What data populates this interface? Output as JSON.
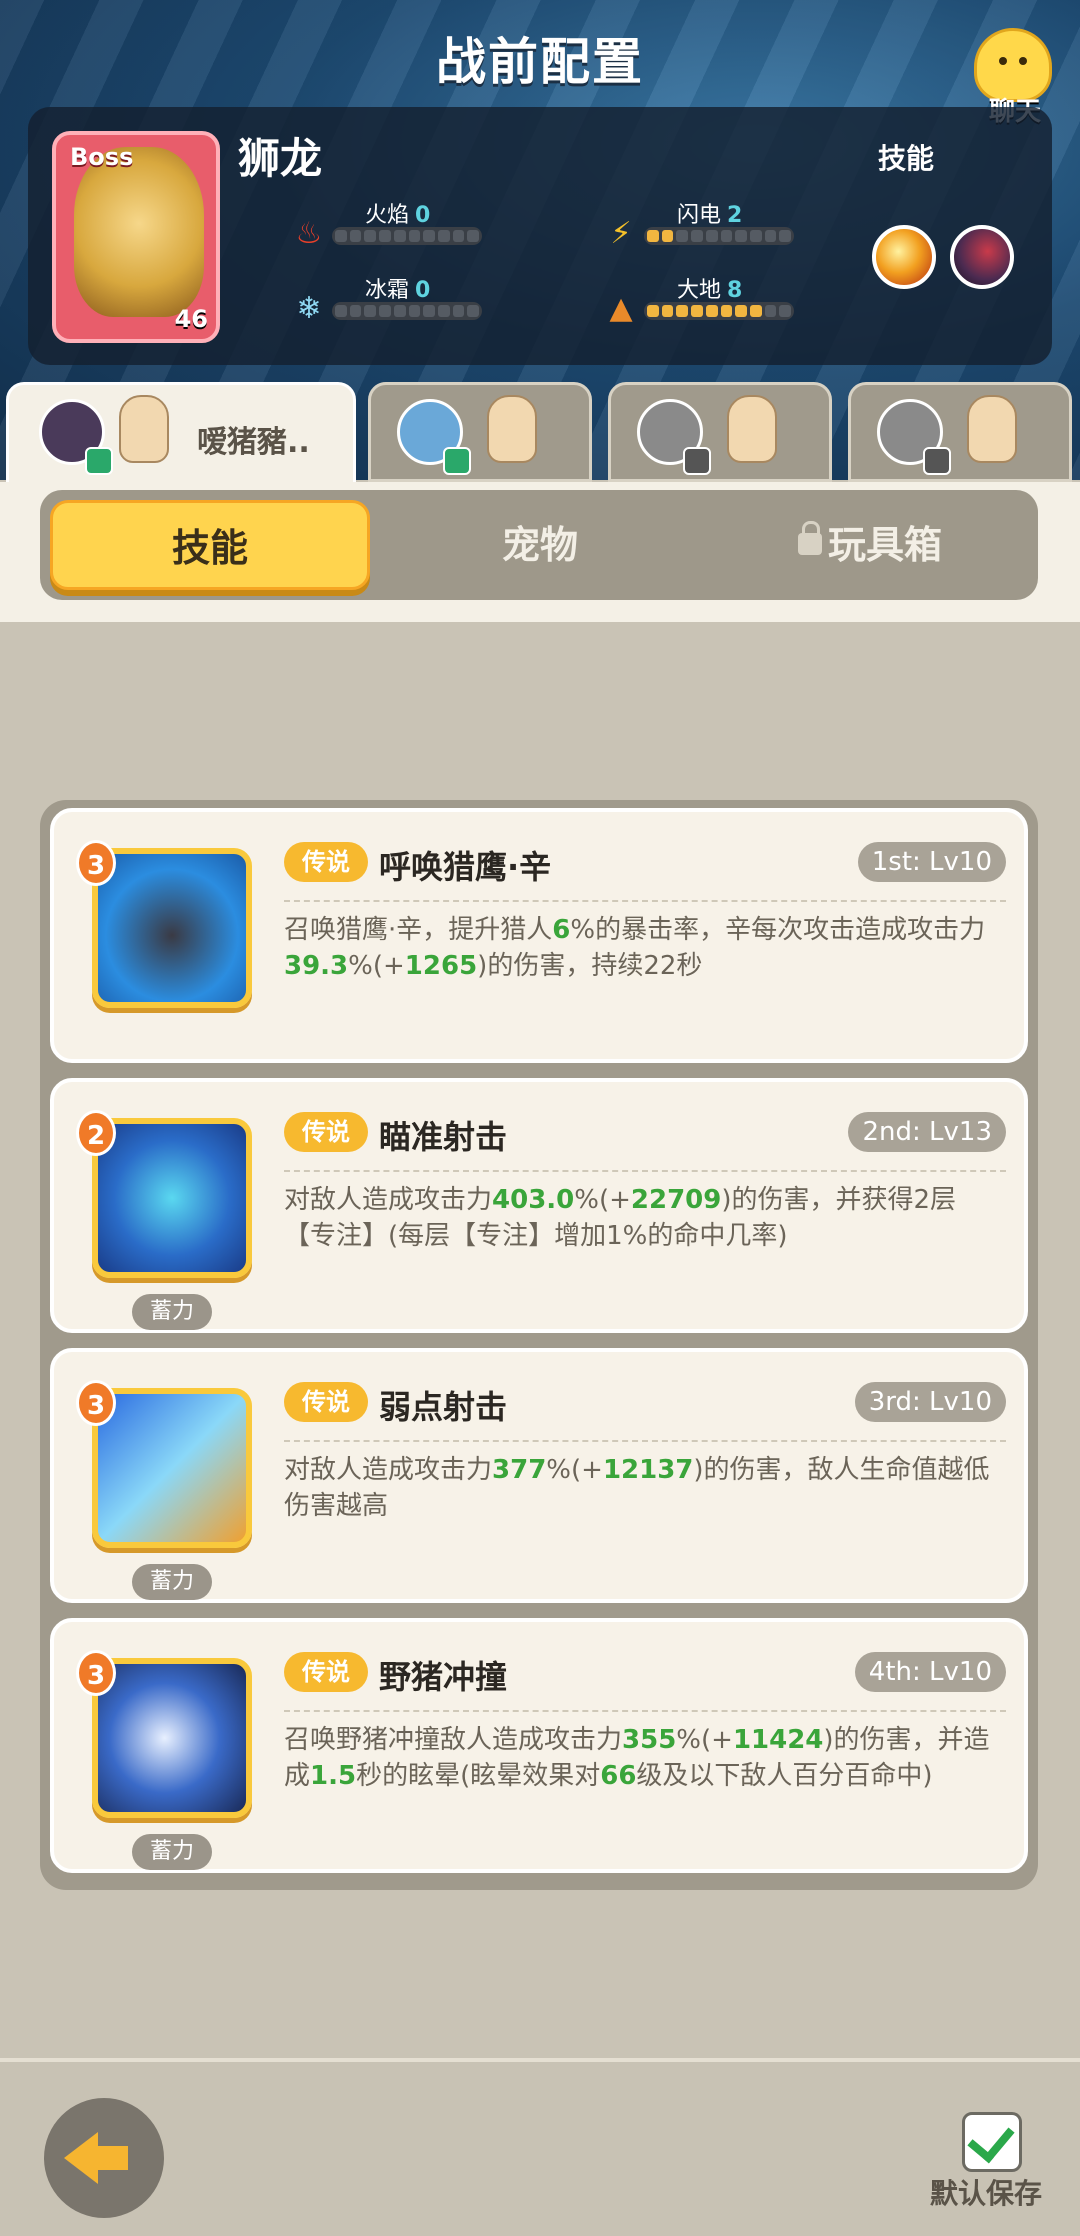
{
  "header": {
    "title": "战前配置",
    "chat_label": "聊天"
  },
  "boss": {
    "tag": "Boss",
    "name": "狮龙",
    "level": "46",
    "elements": [
      {
        "label": "火焰",
        "value": "0",
        "filled": 0,
        "icon": "fire-icon"
      },
      {
        "label": "闪电",
        "value": "2",
        "filled": 2,
        "icon": "lightning-icon"
      },
      {
        "label": "冰霜",
        "value": "0",
        "filled": 0,
        "icon": "frost-icon"
      },
      {
        "label": "大地",
        "value": "8",
        "filled": 8,
        "icon": "earth-icon"
      }
    ],
    "skills_label": "技能"
  },
  "hero_tabs": [
    {
      "name": "嗳猪豬..",
      "active": true,
      "badge": "online"
    },
    {
      "name": "",
      "active": false,
      "badge": "online"
    },
    {
      "name": "",
      "active": false,
      "badge": "offline"
    },
    {
      "name": "",
      "active": false,
      "badge": "offline"
    }
  ],
  "section_tabs": {
    "skills": "技能",
    "pets": "宠物",
    "toybox": "玩具箱"
  },
  "cards": [
    {
      "badge": "3",
      "rarity": "传说",
      "name": "呼唤猎鹰·辛",
      "slot": "1st: Lv10",
      "charge": "",
      "desc_parts": [
        "召唤猎鹰·辛，提升猎人",
        "6",
        "%的暴击率，辛每次攻击造成攻击力",
        "39.3",
        "%(+",
        "1265",
        ")的伤害，持续22秒"
      ]
    },
    {
      "badge": "2",
      "rarity": "传说",
      "name": "瞄准射击",
      "slot": "2nd: Lv13",
      "charge": "蓄力",
      "desc_parts": [
        "对敌人造成攻击力",
        "403.0",
        "%(+",
        "22709",
        ")的伤害，并获得2层【专注】(每层【专注】增加1%的命中几率)"
      ]
    },
    {
      "badge": "3",
      "rarity": "传说",
      "name": "弱点射击",
      "slot": "3rd: Lv10",
      "charge": "蓄力",
      "desc_parts": [
        "对敌人造成攻击力",
        "377",
        "%(+",
        "12137",
        ")的伤害，敌人生命值越低伤害越高"
      ]
    },
    {
      "badge": "3",
      "rarity": "传说",
      "name": "野猪冲撞",
      "slot": "4th: Lv10",
      "charge": "蓄力",
      "desc_parts": [
        "召唤野猪冲撞敌人造成攻击力",
        "355",
        "%(+",
        "11424",
        ")的伤害，并造成",
        "1.5",
        "秒的眩晕(眩晕效果对",
        "66",
        "级及以下敌人百分百命中)"
      ]
    }
  ],
  "footer": {
    "save_label": "默认保存"
  }
}
